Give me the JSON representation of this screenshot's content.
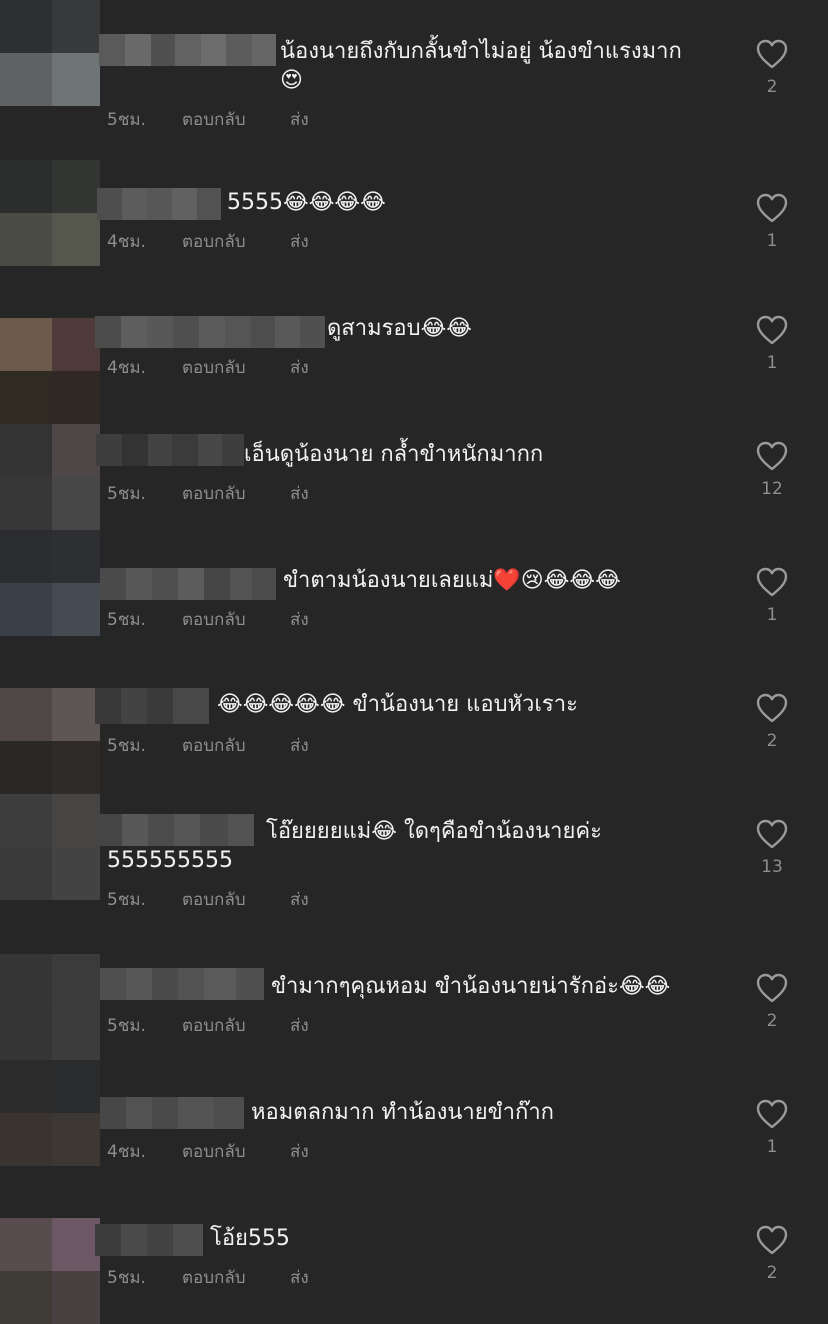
{
  "colors": {
    "background": "#262626",
    "text": "#f2f2f2",
    "meta": "#8e8e8e",
    "heart_outline": "#9a9a9a"
  },
  "comments": [
    {
      "text": "น้องนายถึงกับกลั้นขำไม่อยู่ น้องขำแรงมาก\n😍",
      "time": "5ชม.",
      "reply": "ตอบกลับ",
      "share": "ส่ง",
      "likes": "2",
      "heart_icon": "heart-outline-icon"
    },
    {
      "text": "5555😂😂😂😂",
      "time": "4ชม.",
      "reply": "ตอบกลับ",
      "share": "ส่ง",
      "likes": "1",
      "heart_icon": "heart-outline-icon"
    },
    {
      "text": "ดูสามรอบ😂😂",
      "time": "4ชม.",
      "reply": "ตอบกลับ",
      "share": "ส่ง",
      "likes": "1",
      "heart_icon": "heart-outline-icon"
    },
    {
      "text": "เอ็นดูน้องนาย กล้ำขำหนักมากก",
      "time": "5ชม.",
      "reply": "ตอบกลับ",
      "share": "ส่ง",
      "likes": "12",
      "heart_icon": "heart-outline-icon"
    },
    {
      "text": " ขำตามน้องนายเลยแม่❤️😢😂😂😂",
      "time": "5ชม.",
      "reply": "ตอบกลับ",
      "share": "ส่ง",
      "likes": "1",
      "heart_icon": "heart-outline-icon"
    },
    {
      "text": " 😂😂😂😂😂 ขำน้องนาย แอบหัวเราะ",
      "time": "5ชม.",
      "reply": "ตอบกลับ",
      "share": "ส่ง",
      "likes": "2",
      "heart_icon": "heart-outline-icon"
    },
    {
      "text": "โอ๊ยยยยแม่😂 ใดๆคือขำน้องนายค่ะ\n555555555",
      "time": "5ชม.",
      "reply": "ตอบกลับ",
      "share": "ส่ง",
      "likes": "13",
      "heart_icon": "heart-outline-icon"
    },
    {
      "text": " ขำมากๆคุณหอม ขำน้องนายน่ารักอ่ะ😂😂",
      "time": "5ชม.",
      "reply": "ตอบกลับ",
      "share": "ส่ง",
      "likes": "2",
      "heart_icon": "heart-outline-icon"
    },
    {
      "text": " หอมตลกมาก ทำน้องนายขำก๊าก",
      "time": "4ชม.",
      "reply": "ตอบกลับ",
      "share": "ส่ง",
      "likes": "1",
      "heart_icon": "heart-outline-icon"
    },
    {
      "text": " โอ้ย555",
      "time": "5ชม.",
      "reply": "ตอบกลับ",
      "share": "ส่ง",
      "likes": "2",
      "heart_icon": "heart-outline-icon"
    }
  ]
}
